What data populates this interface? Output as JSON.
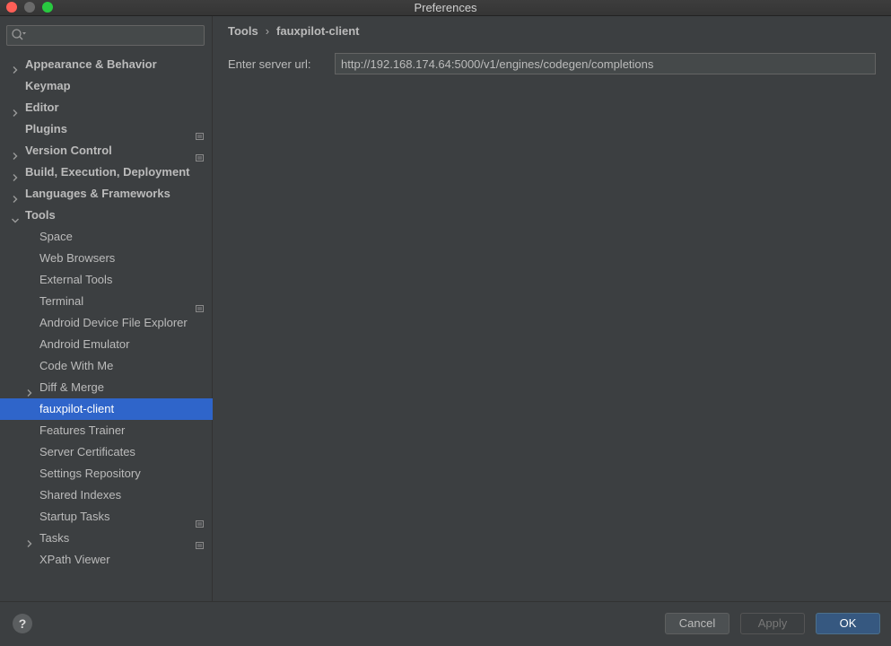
{
  "window": {
    "title": "Preferences"
  },
  "search": {
    "placeholder": ""
  },
  "tree": [
    {
      "label": "Appearance & Behavior",
      "level": 0,
      "expander": "collapsed",
      "project": false
    },
    {
      "label": "Keymap",
      "level": 0,
      "expander": "none",
      "project": false
    },
    {
      "label": "Editor",
      "level": 0,
      "expander": "collapsed",
      "project": false
    },
    {
      "label": "Plugins",
      "level": 0,
      "expander": "none",
      "project": true
    },
    {
      "label": "Version Control",
      "level": 0,
      "expander": "collapsed",
      "project": true
    },
    {
      "label": "Build, Execution, Deployment",
      "level": 0,
      "expander": "collapsed",
      "project": false
    },
    {
      "label": "Languages & Frameworks",
      "level": 0,
      "expander": "collapsed",
      "project": false
    },
    {
      "label": "Tools",
      "level": 0,
      "expander": "expanded",
      "project": false
    },
    {
      "label": "Space",
      "level": 1,
      "expander": "none",
      "project": false
    },
    {
      "label": "Web Browsers",
      "level": 1,
      "expander": "none",
      "project": false
    },
    {
      "label": "External Tools",
      "level": 1,
      "expander": "none",
      "project": false
    },
    {
      "label": "Terminal",
      "level": 1,
      "expander": "none",
      "project": true
    },
    {
      "label": "Android Device File Explorer",
      "level": 1,
      "expander": "none",
      "project": false
    },
    {
      "label": "Android Emulator",
      "level": 1,
      "expander": "none",
      "project": false
    },
    {
      "label": "Code With Me",
      "level": 1,
      "expander": "none",
      "project": false
    },
    {
      "label": "Diff & Merge",
      "level": 1,
      "expander": "collapsed",
      "project": false
    },
    {
      "label": "fauxpilot-client",
      "level": 1,
      "expander": "none",
      "project": false,
      "selected": true
    },
    {
      "label": "Features Trainer",
      "level": 1,
      "expander": "none",
      "project": false
    },
    {
      "label": "Server Certificates",
      "level": 1,
      "expander": "none",
      "project": false
    },
    {
      "label": "Settings Repository",
      "level": 1,
      "expander": "none",
      "project": false
    },
    {
      "label": "Shared Indexes",
      "level": 1,
      "expander": "none",
      "project": false
    },
    {
      "label": "Startup Tasks",
      "level": 1,
      "expander": "none",
      "project": true
    },
    {
      "label": "Tasks",
      "level": 1,
      "expander": "collapsed",
      "project": true
    },
    {
      "label": "XPath Viewer",
      "level": 1,
      "expander": "none",
      "project": false
    }
  ],
  "breadcrumb": {
    "parent": "Tools",
    "separator": "›",
    "current": "fauxpilot-client"
  },
  "form": {
    "url_label": "Enter server url:",
    "url_value": "http://192.168.174.64:5000/v1/engines/codegen/completions"
  },
  "footer": {
    "help_label": "?",
    "cancel_label": "Cancel",
    "apply_label": "Apply",
    "ok_label": "OK"
  },
  "colors": {
    "selection": "#2f65ca",
    "ok_button": "#365880",
    "background": "#3c3f41"
  }
}
